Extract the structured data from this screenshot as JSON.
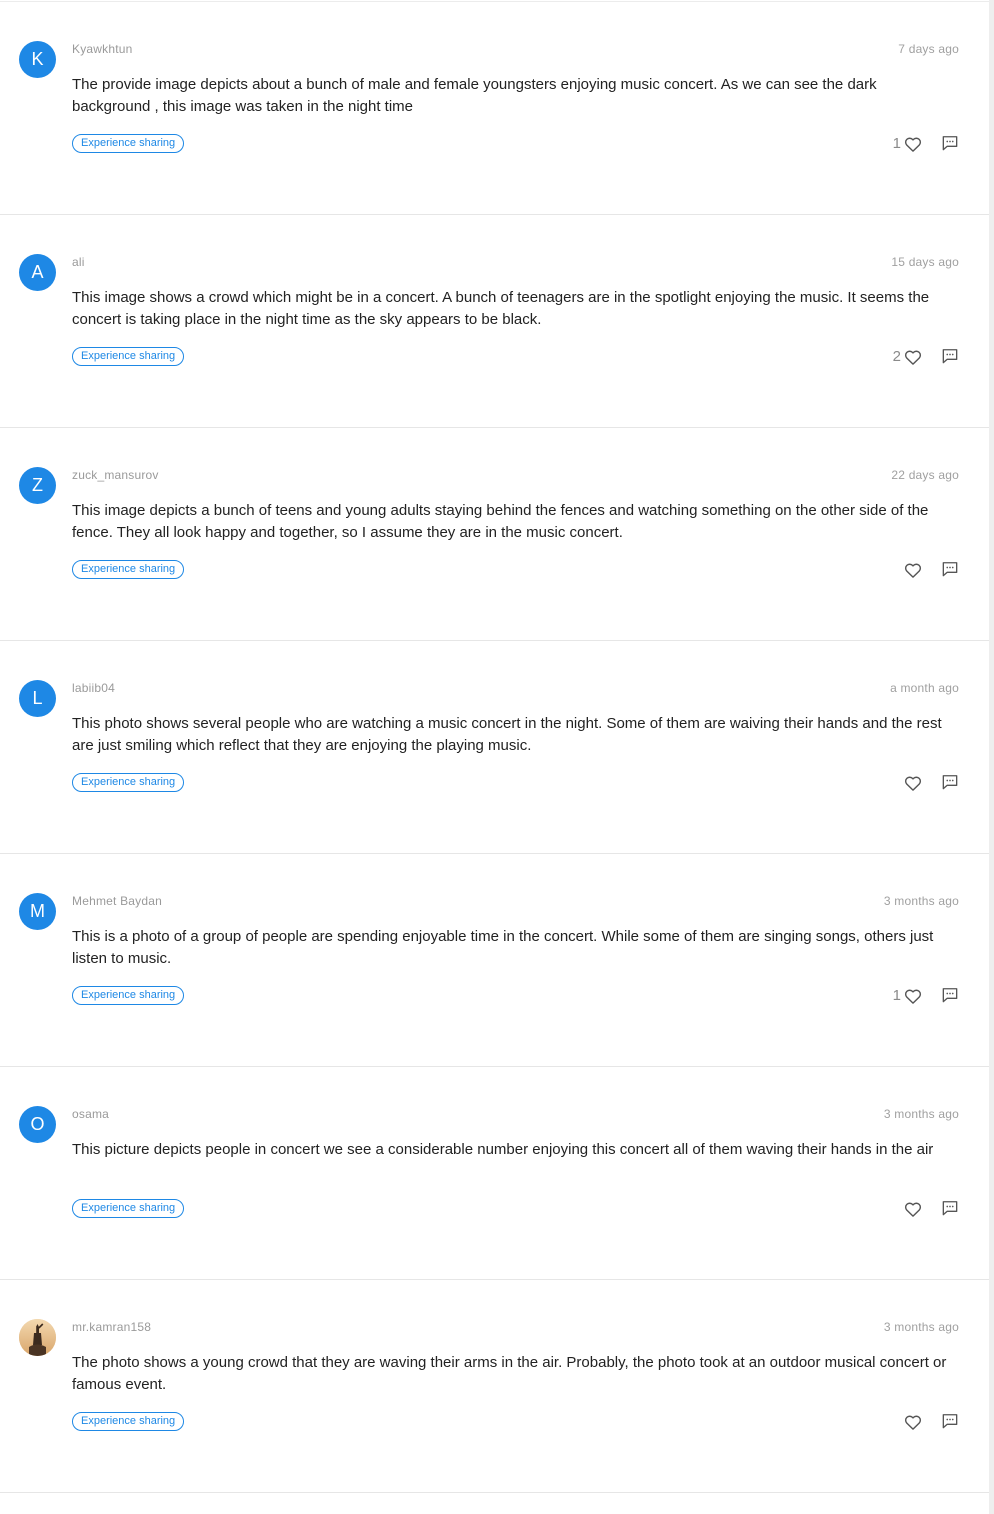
{
  "posts": [
    {
      "initial": "K",
      "username": "Kyawkhtun",
      "time": "7 days ago",
      "text": "The provide image depicts about a bunch of male and female youngsters enjoying music concert. As we can see the dark background , this image was taken in the night time",
      "tag": "Experience sharing",
      "likes": "1"
    },
    {
      "initial": "A",
      "username": "ali",
      "time": "15 days ago",
      "text": "This image shows a crowd which might be in a concert. A bunch of teenagers are in the spotlight enjoying the music. It seems the concert is taking place in the night time as the sky appears to be black.",
      "tag": "Experience sharing",
      "likes": "2"
    },
    {
      "initial": "Z",
      "username": "zuck_mansurov",
      "time": "22 days ago",
      "text": "This image depicts a bunch of teens and young adults staying behind the fences and watching something on the other side of the fence. They all look happy and together, so I assume they are in the music concert.",
      "tag": "Experience sharing",
      "likes": ""
    },
    {
      "initial": "L",
      "username": "labiib04",
      "time": "a month ago",
      "text": "This photo shows several people who are watching a music concert in the night. Some of them are waiving their hands and the rest are just smiling which reflect that they are enjoying the playing music.",
      "tag": "Experience sharing",
      "likes": ""
    },
    {
      "initial": "M",
      "username": "Mehmet Baydan",
      "time": "3 months ago",
      "text": "This is a photo of a group of people are spending enjoyable time in the concert. While some of them are singing songs, others just listen to music.",
      "tag": "Experience sharing",
      "likes": "1"
    },
    {
      "initial": "O",
      "username": "osama",
      "time": "3 months ago",
      "text": "This picture depicts people in concert we see a considerable number enjoying this concert all of them waving their hands in the air",
      "tag": "Experience sharing",
      "likes": ""
    },
    {
      "initial": "",
      "username": "mr.kamran158",
      "time": "3 months ago",
      "text": "The photo shows a young crowd that they are waving their arms in the air. Probably, the photo took at an outdoor musical concert or famous event.",
      "tag": "Experience sharing",
      "likes": ""
    }
  ],
  "icons": {
    "like": "heart-outline-icon",
    "comment": "comment-bubble-icon",
    "photo_avatar": "statue-photo-avatar"
  },
  "colors": {
    "accent": "#1e88e5",
    "meta_text": "#9a9a9a",
    "body_text": "#222222",
    "divider": "#e6e6e6"
  }
}
